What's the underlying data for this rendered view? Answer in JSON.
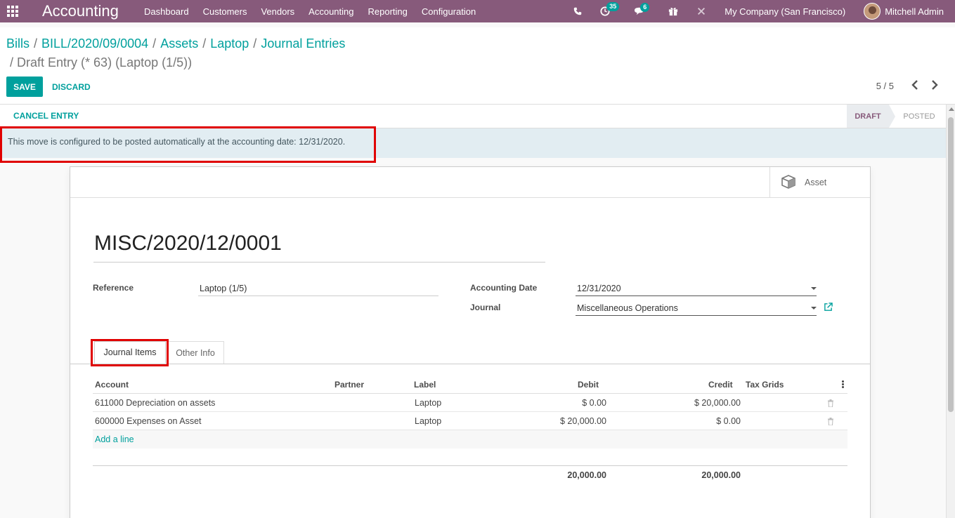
{
  "navbar": {
    "brand": "Accounting",
    "menu": [
      "Dashboard",
      "Customers",
      "Vendors",
      "Accounting",
      "Reporting",
      "Configuration"
    ],
    "activity_count": "35",
    "messages_count": "6",
    "company": "My Company (San Francisco)",
    "user": "Mitchell Admin",
    "icons": [
      "apps-grid-icon",
      "phone-icon",
      "clock-icon",
      "chat-icon",
      "gift-icon",
      "tools-icon"
    ]
  },
  "breadcrumb": {
    "items": [
      "Bills",
      "BILL/2020/09/0004",
      "Assets",
      "Laptop",
      "Journal Entries"
    ],
    "separator": "/",
    "current": "Draft Entry (* 63) (Laptop (1/5))"
  },
  "control": {
    "save_label": "SAVE",
    "discard_label": "DISCARD",
    "pager": "5 / 5"
  },
  "statusbar": {
    "cancel_label": "CANCEL ENTRY",
    "stages": [
      "DRAFT",
      "POSTED"
    ],
    "active_stage": "DRAFT"
  },
  "alert": {
    "message": "This move is configured to be posted automatically at the accounting date: 12/31/2020."
  },
  "sheet": {
    "asset_button": "Asset",
    "name": "MISC/2020/12/0001",
    "reference_label": "Reference",
    "reference_value": "Laptop (1/5)",
    "accounting_date_label": "Accounting Date",
    "accounting_date_value": "12/31/2020",
    "journal_label": "Journal",
    "journal_value": "Miscellaneous Operations",
    "tabs": [
      "Journal Items",
      "Other Info"
    ]
  },
  "table": {
    "columns": [
      "Account",
      "Partner",
      "Label",
      "Debit",
      "Credit",
      "Tax Grids"
    ],
    "rows": [
      {
        "account": "611000 Depreciation on assets",
        "partner": "",
        "label": "Laptop",
        "debit": "$ 0.00",
        "credit": "$ 20,000.00",
        "tax_grids": ""
      },
      {
        "account": "600000 Expenses on Asset",
        "partner": "",
        "label": "Laptop",
        "debit": "$ 20,000.00",
        "credit": "$ 0.00",
        "tax_grids": ""
      }
    ],
    "add_line": "Add a line",
    "total_debit": "20,000.00",
    "total_credit": "20,000.00"
  },
  "colors": {
    "brand": "#875a7b",
    "accent": "#00a09d",
    "highlight": "#e00000"
  }
}
